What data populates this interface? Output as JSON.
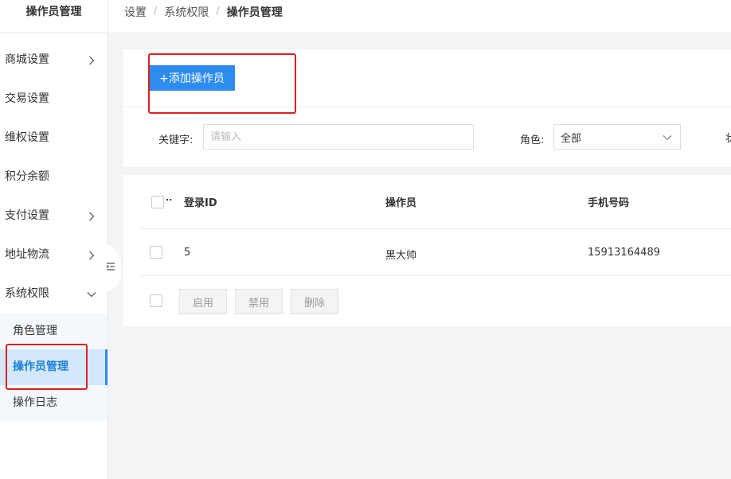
{
  "sidebar": {
    "title": "操作员管理",
    "items": [
      {
        "label": "商城设置",
        "has_children": true
      },
      {
        "label": "交易设置",
        "has_children": false
      },
      {
        "label": "维权设置",
        "has_children": false
      },
      {
        "label": "积分余额",
        "has_children": false
      },
      {
        "label": "支付设置",
        "has_children": true
      },
      {
        "label": "地址物流",
        "has_children": true
      },
      {
        "label": "系统权限",
        "expanded": true
      }
    ],
    "submenu": [
      {
        "label": "角色管理"
      },
      {
        "label": "操作员管理",
        "active": true
      },
      {
        "label": "操作日志"
      }
    ]
  },
  "breadcrumb": {
    "items": [
      "设置",
      "系统权限",
      "操作员管理"
    ],
    "separator": "/"
  },
  "toolbar": {
    "add_label": "+添加操作员"
  },
  "filters": {
    "keyword_label": "关键字:",
    "keyword_placeholder": "请输入",
    "role_label": "角色:",
    "role_value": "全部",
    "truncated_label": "状"
  },
  "table": {
    "headers": {
      "col0": "..",
      "login_id": "登录ID",
      "operator": "操作员",
      "phone": "手机号码"
    },
    "rows": [
      {
        "login_id": "5",
        "operator": "黑大帅",
        "phone": "15913164489"
      }
    ]
  },
  "bulk_actions": {
    "enable": "启用",
    "disable": "禁用",
    "delete": "删除"
  },
  "colors": {
    "primary": "#2d8cf0",
    "active_bg": "#d3e9fb",
    "annotation": "#e02020"
  }
}
